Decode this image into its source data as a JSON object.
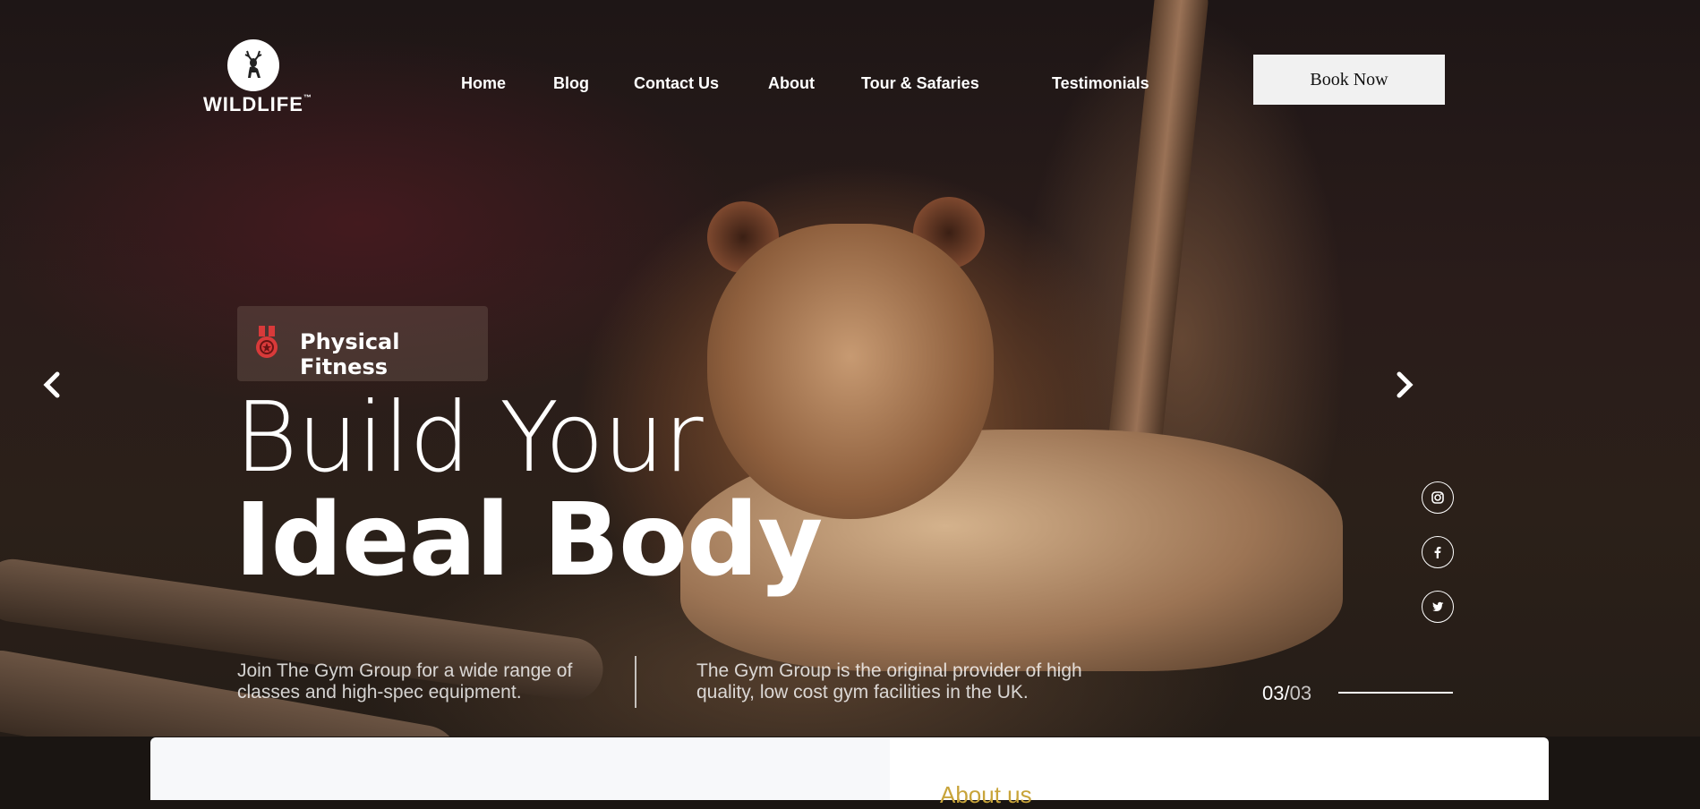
{
  "brand": {
    "logo_text": "WILDLIFE",
    "trademark": "™"
  },
  "nav": {
    "items": [
      {
        "label": "Home"
      },
      {
        "label": "Blog"
      },
      {
        "label": "Contact Us"
      },
      {
        "label": "About"
      },
      {
        "label": "Tour & Safaries"
      },
      {
        "label": "Testimonials"
      }
    ],
    "cta_label": "Book Now"
  },
  "hero": {
    "badge_label": "Physical Fitness",
    "headline_line1": "Build Your",
    "headline_line2": "Ideal Body",
    "desc_left": "Join The Gym Group for a wide range of classes and high-spec equipment.",
    "desc_right": "The Gym Group is the original provider of high quality, low cost gym facilities in the UK.",
    "slide_current": "03/",
    "slide_total": "03",
    "slide_progress": 1.0
  },
  "social": [
    {
      "icon": "instagram-icon"
    },
    {
      "icon": "facebook-icon"
    },
    {
      "icon": "twitter-icon"
    }
  ],
  "about": {
    "label": "About us"
  },
  "colors": {
    "accent": "#c8a43a",
    "badge_icon": "#d83a3a"
  }
}
